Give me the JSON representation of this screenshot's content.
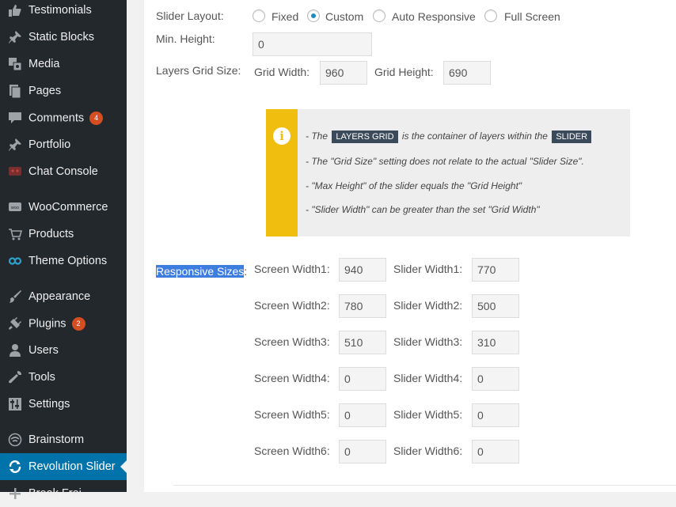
{
  "sidebar": {
    "items": [
      {
        "label": "Testimonials",
        "icon": "thumbs-up-icon"
      },
      {
        "label": "Static Blocks",
        "icon": "pin-icon"
      },
      {
        "label": "Media",
        "icon": "media-icon"
      },
      {
        "label": "Pages",
        "icon": "pages-icon"
      },
      {
        "label": "Comments",
        "icon": "comment-icon",
        "badge": "4"
      },
      {
        "label": "Portfolio",
        "icon": "pin-icon"
      },
      {
        "label": "Chat Console",
        "icon": "chat-icon"
      },
      {
        "label": "WooCommerce",
        "icon": "woo-icon"
      },
      {
        "label": "Products",
        "icon": "cart-icon"
      },
      {
        "label": "Theme Options",
        "icon": "infinity-icon"
      },
      {
        "label": "Appearance",
        "icon": "brush-icon"
      },
      {
        "label": "Plugins",
        "icon": "plug-icon",
        "badge": "2"
      },
      {
        "label": "Users",
        "icon": "user-icon"
      },
      {
        "label": "Tools",
        "icon": "wrench-icon"
      },
      {
        "label": "Settings",
        "icon": "sliders-icon"
      },
      {
        "label": "Brainstorm",
        "icon": "wifi-icon"
      },
      {
        "label": "Revolution Slider",
        "icon": "refresh-icon",
        "active": true
      },
      {
        "label": "Break Frei",
        "icon": "plus-icon"
      }
    ]
  },
  "slider_layout": {
    "label": "Slider Layout:",
    "options": [
      {
        "label": "Fixed",
        "checked": false
      },
      {
        "label": "Custom",
        "checked": true
      },
      {
        "label": "Auto Responsive",
        "checked": false
      },
      {
        "label": "Full Screen",
        "checked": false
      }
    ]
  },
  "min_height": {
    "label": "Min. Height:",
    "value": "0"
  },
  "grid": {
    "label": "Layers Grid Size:",
    "width_label": "Grid Width:",
    "width_value": "960",
    "height_label": "Grid Height:",
    "height_value": "690"
  },
  "info": {
    "line1_pre": "- The",
    "tag1": "LAYERS GRID",
    "line1_mid": "is the container of layers within the",
    "tag2": "SLIDER",
    "line2": "- The \"Grid Size\" setting does not relate to the actual \"Slider Size\".",
    "line3": "- \"Max Height\" of the slider equals the \"Grid Height\"",
    "line4": "- \"Slider Width\" can be greater than the set \"Grid Width\""
  },
  "responsive": {
    "label": "Responsive Sizes",
    "colon": ":",
    "rows": [
      {
        "screen_label": "Screen Width1:",
        "screen_value": "940",
        "slider_label": "Slider Width1:",
        "slider_value": "770"
      },
      {
        "screen_label": "Screen Width2:",
        "screen_value": "780",
        "slider_label": "Slider Width2:",
        "slider_value": "500"
      },
      {
        "screen_label": "Screen Width3:",
        "screen_value": "510",
        "slider_label": "Slider Width3:",
        "slider_value": "310"
      },
      {
        "screen_label": "Screen Width4:",
        "screen_value": "0",
        "slider_label": "Slider Width4:",
        "slider_value": "0"
      },
      {
        "screen_label": "Screen Width5:",
        "screen_value": "0",
        "slider_label": "Slider Width5:",
        "slider_value": "0"
      },
      {
        "screen_label": "Screen Width6:",
        "screen_value": "0",
        "slider_label": "Slider Width6:",
        "slider_value": "0"
      }
    ]
  }
}
